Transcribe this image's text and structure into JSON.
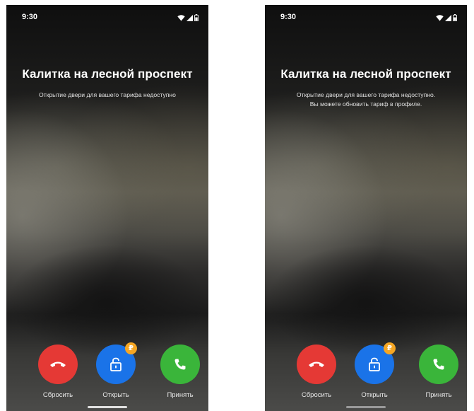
{
  "screens": [
    {
      "status_bar": {
        "time": "9:30",
        "icons": [
          "wifi-icon",
          "cellular-signal-icon",
          "battery-icon"
        ]
      },
      "caller": {
        "title": "Калитка на лесной проспект",
        "subtitle_lines": [
          "Открытие двери для вашего тарифа недоступно"
        ]
      },
      "actions": {
        "decline": {
          "label": "Сбросить",
          "icon": "hang-up-icon",
          "color": "#e53935"
        },
        "open": {
          "label": "Открыть",
          "icon": "unlock-icon",
          "color": "#1a73e8",
          "badge": "₽",
          "badge_color": "#f5a623"
        },
        "accept": {
          "label": "Принять",
          "icon": "phone-icon",
          "color": "#3ab53a"
        }
      }
    },
    {
      "status_bar": {
        "time": "9:30",
        "icons": [
          "wifi-icon",
          "cellular-signal-icon",
          "battery-icon"
        ]
      },
      "caller": {
        "title": "Калитка на лесной проспект",
        "subtitle_lines": [
          "Открытие двери для вашего тарифа недоступно.",
          "Вы можете обновить тариф в профиле."
        ]
      },
      "actions": {
        "decline": {
          "label": "Сбросить",
          "icon": "hang-up-icon",
          "color": "#e53935"
        },
        "open": {
          "label": "Открыть",
          "icon": "unlock-icon",
          "color": "#1a73e8",
          "badge": "₽",
          "badge_color": "#f5a623"
        },
        "accept": {
          "label": "Принять",
          "icon": "phone-icon",
          "color": "#3ab53a"
        }
      }
    }
  ]
}
